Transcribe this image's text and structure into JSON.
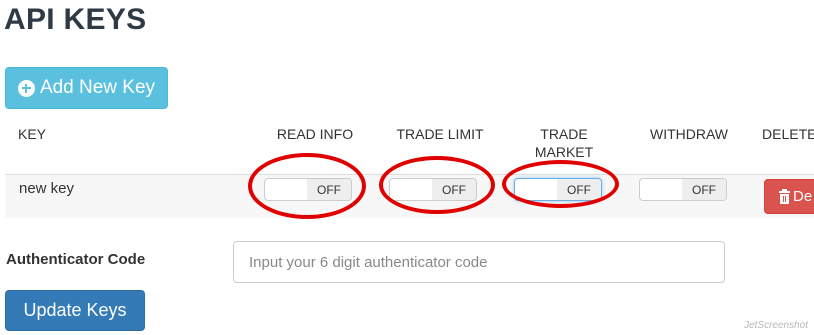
{
  "page": {
    "title": "API KEYS"
  },
  "toolbar": {
    "add_label": "Add New Key"
  },
  "table": {
    "headers": {
      "key": "KEY",
      "read_info": "READ INFO",
      "trade_limit": "TRADE LIMIT",
      "trade_market_line1": "TRADE",
      "trade_market_line2": "MARKET",
      "withdraw": "WITHDRAW",
      "delete": "DELETE"
    },
    "rows": [
      {
        "name": "new key",
        "read_info": "OFF",
        "trade_limit": "OFF",
        "trade_market": "OFF",
        "withdraw": "OFF",
        "delete_label": "De"
      }
    ]
  },
  "auth": {
    "label": "Authenticator Code",
    "placeholder": "Input your 6 digit authenticator code",
    "value": ""
  },
  "actions": {
    "update_label": "Update Keys"
  },
  "annotations": {
    "highlight_color": "#e00000"
  },
  "watermark": {
    "text": "JetScreenshot"
  },
  "colors": {
    "add_button": "#5bc0de",
    "delete_button": "#d9534f",
    "update_button": "#337ab7"
  }
}
